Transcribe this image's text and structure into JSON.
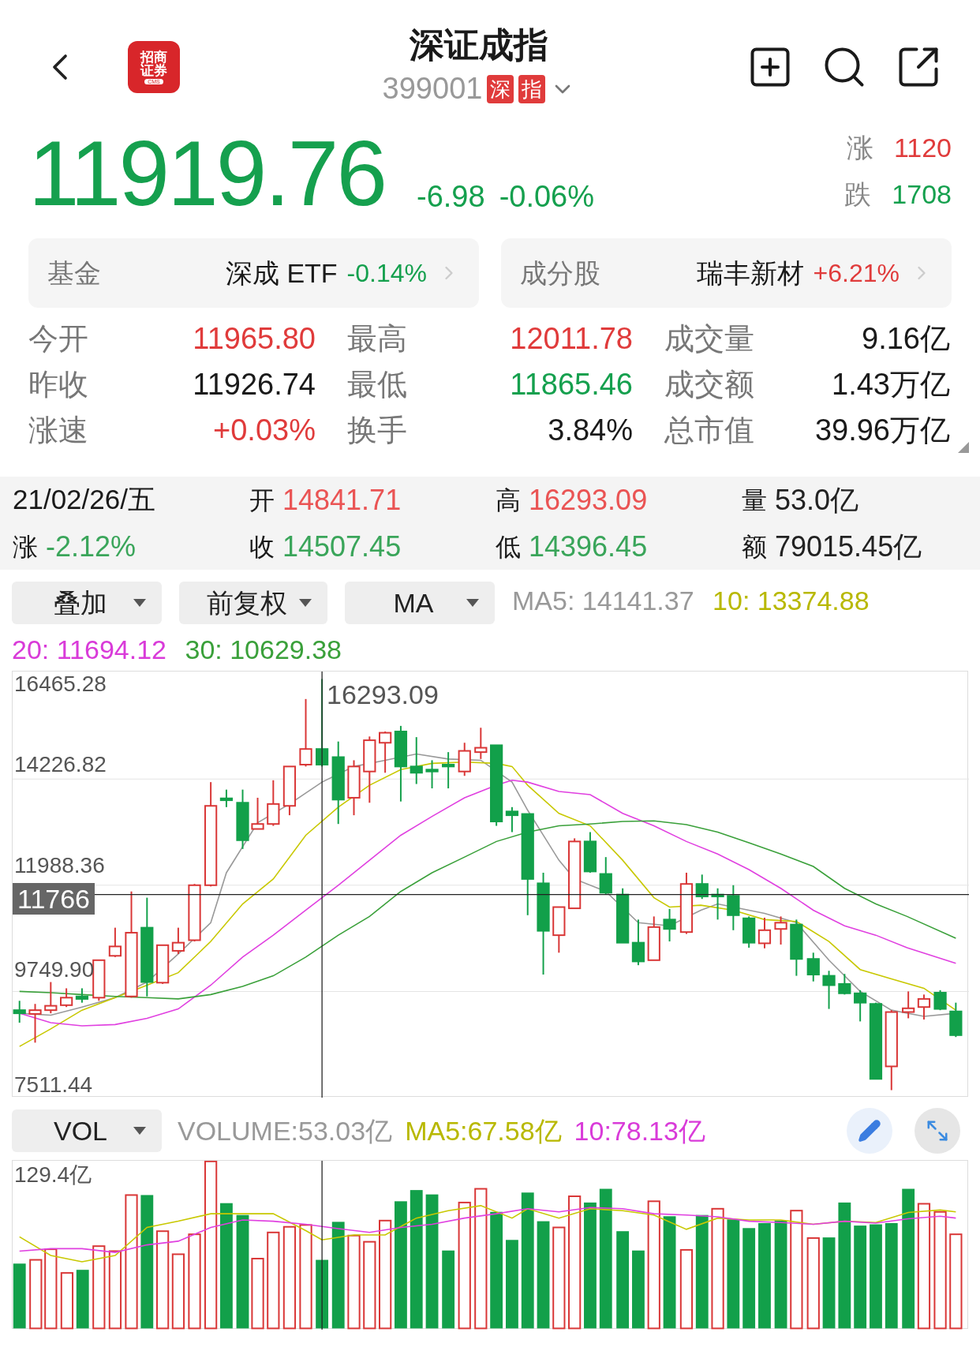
{
  "header": {
    "logo": {
      "lines": [
        "招商",
        "证券"
      ],
      "sub": "CMS"
    },
    "title": "深证成指",
    "code": "399001",
    "badges": [
      "深",
      "指"
    ]
  },
  "quote": {
    "price": "11919.76",
    "change": "-6.98",
    "change_pct": "-0.06%",
    "color": "#15a04e",
    "breadth": [
      {
        "label": "涨",
        "value": "1120",
        "color": "#e03b3b"
      },
      {
        "label": "跌",
        "value": "1708",
        "color": "#15a04e"
      }
    ]
  },
  "cards": [
    {
      "label": "基金",
      "name": "深成 ETF",
      "value": "-0.14%",
      "color": "#15a04e"
    },
    {
      "label": "成分股",
      "name": "瑞丰新材",
      "value": "+6.21%",
      "color": "#e03b3b"
    }
  ],
  "stats": [
    {
      "label": "今开",
      "value": "11965.80",
      "color": "#e03b3b"
    },
    {
      "label": "最高",
      "value": "12011.78",
      "color": "#e03b3b"
    },
    {
      "label": "成交量",
      "value": "9.16亿",
      "color": "#1a1a1a"
    },
    {
      "label": "昨收",
      "value": "11926.74",
      "color": "#1a1a1a"
    },
    {
      "label": "最低",
      "value": "11865.46",
      "color": "#15a04e"
    },
    {
      "label": "成交额",
      "value": "1.43万亿",
      "color": "#1a1a1a"
    },
    {
      "label": "涨速",
      "value": "+0.03%",
      "color": "#e03b3b"
    },
    {
      "label": "换手",
      "value": "3.84%",
      "color": "#1a1a1a"
    },
    {
      "label": "总市值",
      "value": "39.96万亿",
      "color": "#1a1a1a"
    }
  ],
  "day_bar": [
    {
      "kind": "date",
      "value": "21/02/26/五"
    },
    {
      "kind": "pair",
      "label": "开",
      "value": "14841.71",
      "color": "#ea5454"
    },
    {
      "kind": "pair",
      "label": "高",
      "value": "16293.09",
      "color": "#ea5454"
    },
    {
      "kind": "pair",
      "label": "量",
      "value": "53.0亿",
      "color": "#222222"
    },
    {
      "kind": "pair",
      "label": "涨",
      "value": "-2.12%",
      "color": "#3aa55a"
    },
    {
      "kind": "pair",
      "label": "收",
      "value": "14507.45",
      "color": "#3aa55a"
    },
    {
      "kind": "pair",
      "label": "低",
      "value": "14396.45",
      "color": "#3aa55a"
    },
    {
      "kind": "pair",
      "label": "额",
      "value": "79015.45亿",
      "color": "#222222"
    }
  ],
  "overlay_toolbar": {
    "dropdowns": [
      "叠加",
      "前复权",
      "MA"
    ],
    "ma_legend": [
      {
        "label": "MA5:",
        "value": "14141.37",
        "color": "#999999"
      },
      {
        "label": "10:",
        "value": "13374.88",
        "color": "#b8b800"
      },
      {
        "label": "20:",
        "value": "11694.12",
        "color": "#d93bd9"
      },
      {
        "label": "30:",
        "value": "10629.38",
        "color": "#3aa03a"
      }
    ]
  },
  "kline": {
    "y_labels": [
      "16465.28",
      "14226.82",
      "11988.36",
      "9749.90",
      "7511.44"
    ],
    "high_label": "16293.09",
    "cursor_label": "11766"
  },
  "volume_toolbar": {
    "dropdown": "VOL",
    "legend": [
      {
        "label": "VOLUME:",
        "value": "53.03亿",
        "color": "#999999"
      },
      {
        "label": "MA5:",
        "value": "67.58亿",
        "color": "#b8b800"
      },
      {
        "label": "10:",
        "value": "78.13亿",
        "color": "#d93bd9"
      }
    ]
  },
  "volume": {
    "max_label": "129.4亿"
  }
}
